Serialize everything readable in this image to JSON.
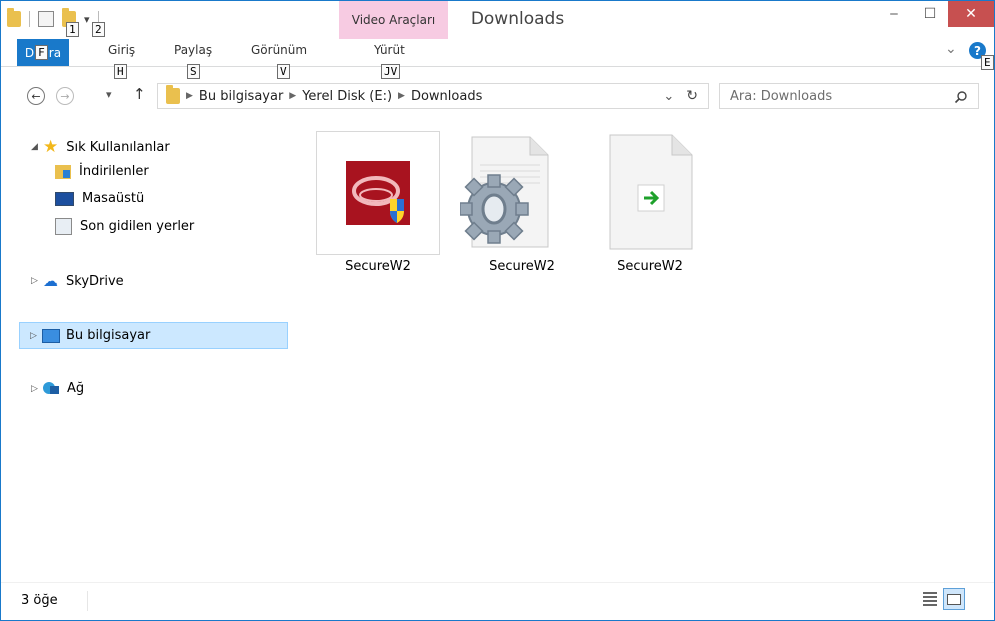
{
  "window": {
    "title": "Downloads",
    "contextual_tab": "Video Araçları",
    "minimize": "‒",
    "maximize": "☐",
    "close": "✕"
  },
  "qat": {
    "keytip_1": "1",
    "keytip_2": "2",
    "dropdown": "▾"
  },
  "ribbon": {
    "file_tab": "Dosya",
    "file_tab_visible": "D",
    "file_tab_tail": "ra",
    "tabs": [
      "Giriş",
      "Paylaş",
      "Görünüm",
      "Yürüt"
    ],
    "keytips": {
      "file": "F",
      "home": "H",
      "share": "S",
      "view": "V",
      "play": "JV",
      "help": "E"
    },
    "expand": "⌄",
    "help": "?"
  },
  "address_bar": {
    "back": "←",
    "forward": "→",
    "recent": "▾",
    "up": "↑",
    "breadcrumb": [
      "Bu bilgisayar",
      "Yerel Disk (E:)",
      "Downloads"
    ],
    "dropdown": "⌄",
    "refresh": "↻"
  },
  "search": {
    "placeholder": "Ara: Downloads",
    "icon": "search-icon"
  },
  "nav_pane": {
    "favorites": "Sık Kullanılanlar",
    "favorites_items": [
      "İndirilenler",
      "Masaüstü",
      "Son gidilen yerler"
    ],
    "skydrive": "SkyDrive",
    "this_pc": "Bu bilgisayar",
    "network": "Ağ"
  },
  "files": [
    {
      "name": "SecureW2",
      "icon": "installer-icon"
    },
    {
      "name": "SecureW2",
      "icon": "settings-file-icon"
    },
    {
      "name": "SecureW2",
      "icon": "shortcut-file-icon"
    }
  ],
  "status_bar": {
    "item_count": "3 öğe"
  },
  "colors": {
    "accent": "#1979ca",
    "contextual": "#f7cbe2",
    "close": "#c75050",
    "selection": "#cce8ff"
  }
}
